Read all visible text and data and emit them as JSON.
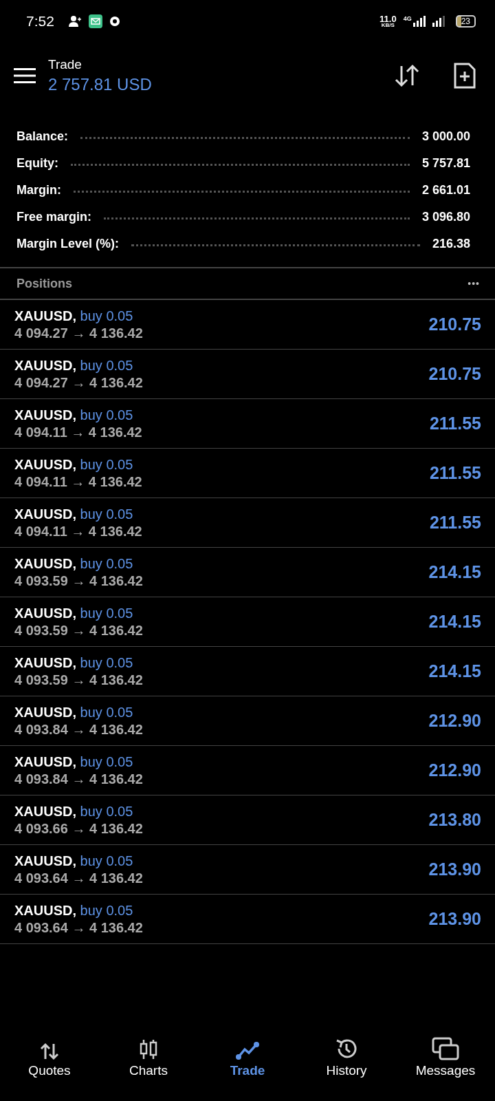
{
  "status_bar": {
    "time": "7:52",
    "speed": "11.0",
    "speed_unit": "KB/S",
    "network": "4G",
    "battery": "23"
  },
  "header": {
    "title": "Trade",
    "balance": "2 757.81 USD"
  },
  "summary": [
    {
      "label": "Balance:",
      "value": "3 000.00"
    },
    {
      "label": "Equity:",
      "value": "5 757.81"
    },
    {
      "label": "Margin:",
      "value": "2 661.01"
    },
    {
      "label": "Free margin:",
      "value": "3 096.80"
    },
    {
      "label": "Margin Level (%):",
      "value": "216.38"
    }
  ],
  "positions": {
    "title": "Positions",
    "more": "•••",
    "rows": [
      {
        "symbol": "XAUUSD,",
        "side": "buy 0.05",
        "prices": "4 094.27 → 4 136.42",
        "profit": "210.75"
      },
      {
        "symbol": "XAUUSD,",
        "side": "buy 0.05",
        "prices": "4 094.27 → 4 136.42",
        "profit": "210.75"
      },
      {
        "symbol": "XAUUSD,",
        "side": "buy 0.05",
        "prices": "4 094.11 → 4 136.42",
        "profit": "211.55"
      },
      {
        "symbol": "XAUUSD,",
        "side": "buy 0.05",
        "prices": "4 094.11 → 4 136.42",
        "profit": "211.55"
      },
      {
        "symbol": "XAUUSD,",
        "side": "buy 0.05",
        "prices": "4 094.11 → 4 136.42",
        "profit": "211.55"
      },
      {
        "symbol": "XAUUSD,",
        "side": "buy 0.05",
        "prices": "4 093.59 → 4 136.42",
        "profit": "214.15"
      },
      {
        "symbol": "XAUUSD,",
        "side": "buy 0.05",
        "prices": "4 093.59 → 4 136.42",
        "profit": "214.15"
      },
      {
        "symbol": "XAUUSD,",
        "side": "buy 0.05",
        "prices": "4 093.59 → 4 136.42",
        "profit": "214.15"
      },
      {
        "symbol": "XAUUSD,",
        "side": "buy 0.05",
        "prices": "4 093.84 → 4 136.42",
        "profit": "212.90"
      },
      {
        "symbol": "XAUUSD,",
        "side": "buy 0.05",
        "prices": "4 093.84 → 4 136.42",
        "profit": "212.90"
      },
      {
        "symbol": "XAUUSD,",
        "side": "buy 0.05",
        "prices": "4 093.66 → 4 136.42",
        "profit": "213.80"
      },
      {
        "symbol": "XAUUSD,",
        "side": "buy 0.05",
        "prices": "4 093.64 → 4 136.42",
        "profit": "213.90"
      },
      {
        "symbol": "XAUUSD,",
        "side": "buy 0.05",
        "prices": "4 093.64 → 4 136.42",
        "profit": "213.90"
      }
    ]
  },
  "nav": [
    {
      "label": "Quotes",
      "kind": "quotes",
      "selected": false
    },
    {
      "label": "Charts",
      "kind": "charts",
      "selected": false
    },
    {
      "label": "Trade",
      "kind": "trade",
      "selected": true
    },
    {
      "label": "History",
      "kind": "history",
      "selected": false
    },
    {
      "label": "Messages",
      "kind": "messages",
      "selected": false
    }
  ]
}
